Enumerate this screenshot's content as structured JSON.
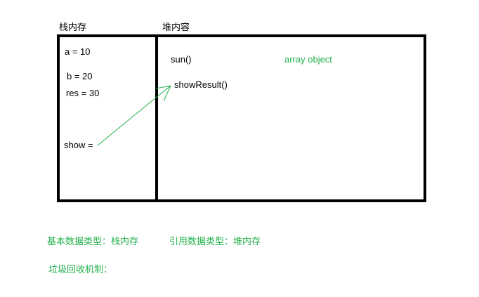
{
  "stack": {
    "title": "栈内存",
    "vars": [
      {
        "label": "a = 10"
      },
      {
        "label": "b = 20"
      },
      {
        "label": "res = 30"
      },
      {
        "label": "show ="
      }
    ]
  },
  "heap": {
    "title": "堆内容",
    "items": [
      {
        "label": "sun()"
      },
      {
        "label": "showResult()"
      }
    ],
    "array_object": "array object"
  },
  "legend": {
    "primitive": "基本数据类型：栈内存",
    "reference": "引用数据类型：堆内存",
    "gc": "垃圾回收机制："
  },
  "colors": {
    "box_border": "#000000",
    "arrow": "#22b14c",
    "annotation": "#22b14c"
  },
  "icons": {
    "pointer": "arrow-icon"
  }
}
